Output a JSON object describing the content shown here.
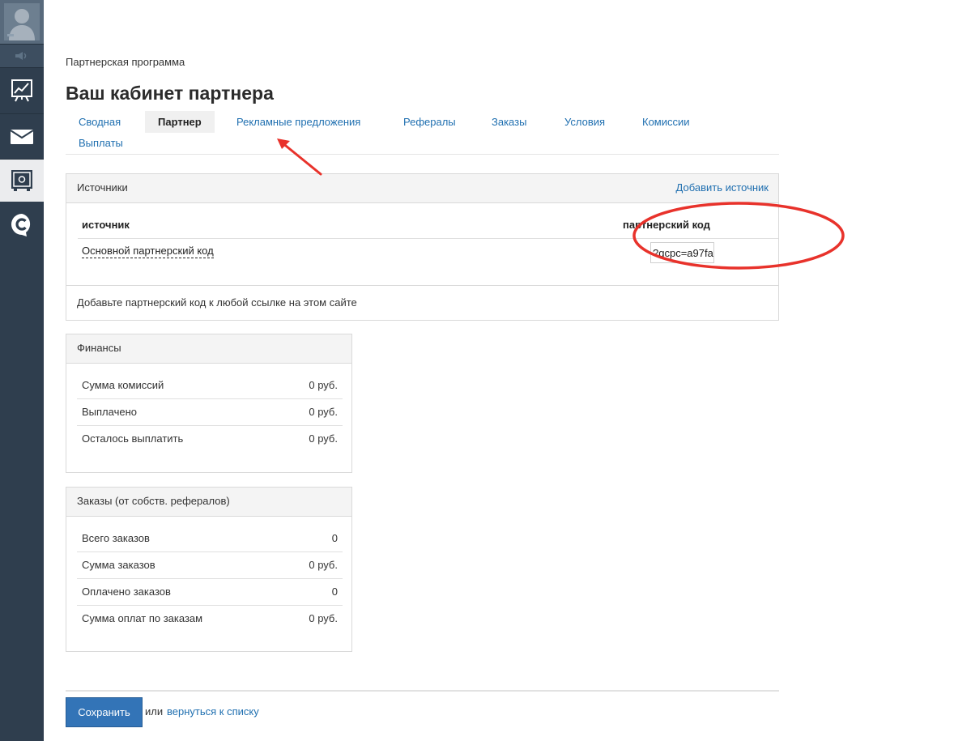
{
  "sidebar": {
    "items": [
      {
        "name": "user-avatar-icon"
      },
      {
        "name": "sound-icon"
      },
      {
        "name": "chart-board-icon"
      },
      {
        "name": "mail-icon"
      },
      {
        "name": "safe-icon"
      },
      {
        "name": "c-logo-icon"
      }
    ]
  },
  "breadcrumb": "Партнерская программа",
  "page_title": "Ваш кабинет партнера",
  "tabs": [
    {
      "label": "Сводная"
    },
    {
      "label": "Партнер"
    },
    {
      "label": "Рекламные предложения"
    },
    {
      "label": "Рефералы"
    },
    {
      "label": "Заказы"
    },
    {
      "label": "Условия"
    },
    {
      "label": "Комиссии"
    },
    {
      "label": "Выплаты"
    }
  ],
  "active_tab": "Партнер",
  "sources": {
    "title": "Источники",
    "add_link": "Добавить источник",
    "col_source": "источник",
    "col_code": "партнерский код",
    "rows": [
      {
        "name": "Основной партнерский код",
        "code": "?gcpc=a97fa"
      }
    ],
    "footer": "Добавьте партнерский код к любой ссылке на этом сайте"
  },
  "finance": {
    "title": "Финансы",
    "rows": [
      {
        "label": "Сумма комиссий",
        "value": "0 руб."
      },
      {
        "label": "Выплачено",
        "value": "0 руб."
      },
      {
        "label": "Осталось выплатить",
        "value": "0 руб."
      }
    ]
  },
  "orders": {
    "title": "Заказы (от собств. рефералов)",
    "rows": [
      {
        "label": "Всего заказов",
        "value": "0"
      },
      {
        "label": "Сумма заказов",
        "value": "0 руб."
      },
      {
        "label": "Оплачено заказов",
        "value": "0"
      },
      {
        "label": "Сумма оплат по заказам",
        "value": "0 руб."
      }
    ]
  },
  "footer": {
    "save_label": "Сохранить",
    "or_text": "или",
    "back_link": "вернуться к списку"
  },
  "colors": {
    "sidebar_bg": "#2f3e4e",
    "link": "#1f6fb0",
    "primary_button": "#3374b7",
    "annotation_red": "#e8322b"
  }
}
